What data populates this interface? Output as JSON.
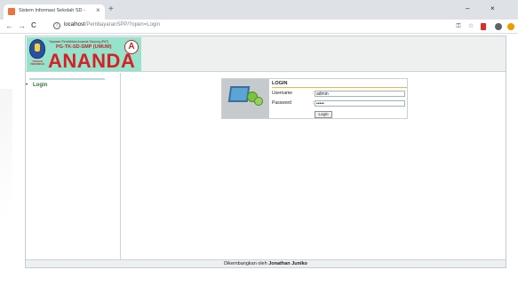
{
  "browser": {
    "tab_title": "Sistem Informasi Sekolah SD -",
    "tab_close": "×",
    "new_tab": "+",
    "minimize": "–",
    "maximize": "▢",
    "close": "×",
    "back": "←",
    "forward": "→",
    "reload": "C",
    "url_host": "localhost",
    "url_path": "/PembayaranSPP/?open=Login",
    "icons": [
      "key-icon",
      "star-icon",
      "extension-icon",
      "profile-icon",
      "update-icon"
    ]
  },
  "header": {
    "yayasan": "Yayasan Pendidikan Ananda Tanjung (PAT)",
    "schools": "PG-TK-SD-SMP (UMUM)",
    "brand": "ANANDA",
    "logo_right_letter": "A",
    "logo_left_caption": "YAYASAN PENDIDIKAN"
  },
  "sidebar": {
    "bullet": "•",
    "items": [
      {
        "label": "Login"
      }
    ]
  },
  "login": {
    "title": "LOGIN",
    "username_label": "Username",
    "password_label": "Password",
    "colon": ":",
    "username_value": "admin",
    "password_value": "•••••",
    "button_label": "Login"
  },
  "footer": {
    "prefix": "Dikembangkan oleh ",
    "author": "Jonathan Juniko"
  },
  "colors": {
    "brand_red": "#d62027",
    "banner_bg": "#96e2ca",
    "sidebar_link": "#2d7a35"
  }
}
